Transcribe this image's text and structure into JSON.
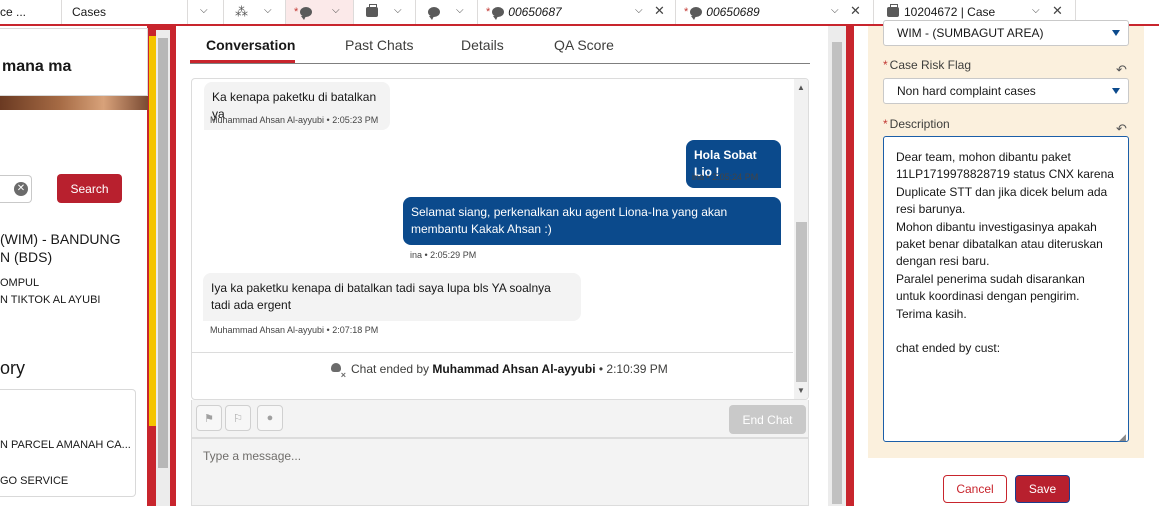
{
  "tabs": [
    {
      "label": "ce ..."
    },
    {
      "label": "Cases"
    },
    {
      "label": ""
    },
    {
      "label": ""
    },
    {
      "required": "*",
      "label": ""
    },
    {
      "label": ""
    },
    {
      "label": ""
    },
    {
      "required": "*",
      "label": "00650687"
    },
    {
      "required": "*",
      "label": "00650689"
    },
    {
      "label": "10204672 | Case"
    }
  ],
  "left": {
    "card_title": "mana ma",
    "search_label": "Search",
    "address_line1": "(WIM) - BANDUNG",
    "address_line2": "N (BDS)",
    "info_line1": "OMPUL",
    "info_line2": "N TIKTOK AL AYUBI",
    "history_title": "ory",
    "history_item1": "N PARCEL AMANAH CA...",
    "history_item2": "GO SERVICE"
  },
  "chat": {
    "tabs": [
      "Conversation",
      "Past Chats",
      "Details",
      "QA Score"
    ],
    "messages": [
      {
        "side": "in",
        "text": "Ka kenapa paketku di batalkan ya",
        "meta": "Muhammad Ahsan Al-ayyubi • 2:05:23 PM"
      },
      {
        "side": "out",
        "text": "Hola Sobat Lio !",
        "meta": "ina • 2:05:24 PM"
      },
      {
        "side": "out",
        "text": "Selamat siang, perkenalkan aku agent Liona-Ina yang akan membantu Kakak Ahsan :)",
        "meta": "ina • 2:05:29 PM"
      },
      {
        "side": "in",
        "text": "Iya ka paketku kenapa di batalkan tadi saya lupa bls YA soalnya tadi ada ergent",
        "meta": "Muhammad Ahsan Al-ayyubi • 2:07:18 PM"
      }
    ],
    "ended_prefix": "Chat ended by",
    "ended_name": "Muhammad Ahsan Al-ayyubi",
    "ended_time": "• 2:10:39 PM",
    "end_chat_label": "End Chat",
    "composer_placeholder": "Type a message..."
  },
  "form": {
    "area_value": "WIM - (SUMBAGUT AREA)",
    "risk_label": "Case Risk Flag",
    "risk_value": "Non hard complaint cases",
    "description_label": "Description",
    "required_mark": "*",
    "description_value": "Dear team, mohon dibantu paket 11LP1719978828719 status CNX karena Duplicate STT dan jika dicek belum ada resi barunya.\nMohon dibantu investigasinya apakah paket benar dibatalkan atau diteruskan dengan resi baru.\nParalel penerima sudah disarankan untuk koordinasi dengan pengirim. Terima kasih.\n\nchat ended by cust:",
    "cancel_label": "Cancel",
    "save_label": "Save"
  },
  "colors": {
    "brand_red": "#c8252d",
    "agent_bubble": "#0b4a8c",
    "form_bg": "#fbf0dd"
  }
}
